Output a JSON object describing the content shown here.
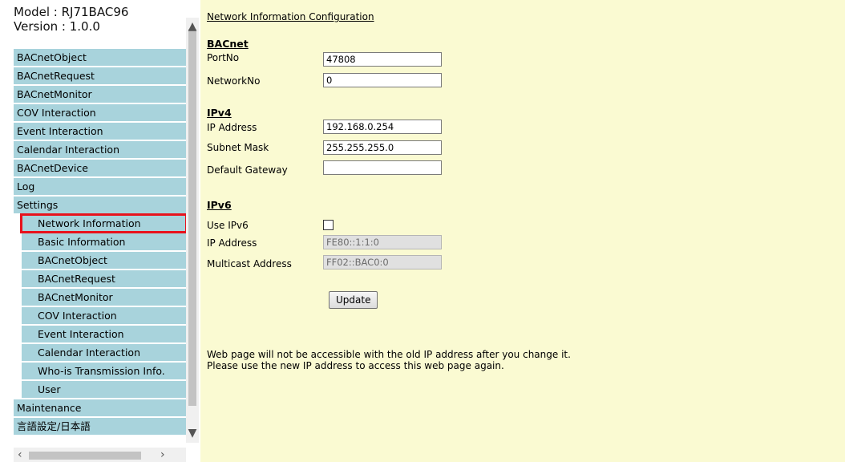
{
  "sidebar": {
    "model_line": "Model : RJ71BAC96",
    "version_line": "Version : 1.0.0",
    "items": [
      {
        "label": "BACnetObject",
        "sub": false,
        "selected": false
      },
      {
        "label": "BACnetRequest",
        "sub": false,
        "selected": false
      },
      {
        "label": "BACnetMonitor",
        "sub": false,
        "selected": false
      },
      {
        "label": "COV Interaction",
        "sub": false,
        "selected": false
      },
      {
        "label": "Event Interaction",
        "sub": false,
        "selected": false
      },
      {
        "label": "Calendar Interaction",
        "sub": false,
        "selected": false
      },
      {
        "label": "BACnetDevice",
        "sub": false,
        "selected": false
      },
      {
        "label": "Log",
        "sub": false,
        "selected": false
      },
      {
        "label": "Settings",
        "sub": false,
        "selected": false
      },
      {
        "label": "Network Information",
        "sub": true,
        "selected": true
      },
      {
        "label": "Basic Information",
        "sub": true,
        "selected": false
      },
      {
        "label": "BACnetObject",
        "sub": true,
        "selected": false
      },
      {
        "label": "BACnetRequest",
        "sub": true,
        "selected": false
      },
      {
        "label": "BACnetMonitor",
        "sub": true,
        "selected": false
      },
      {
        "label": "COV Interaction",
        "sub": true,
        "selected": false
      },
      {
        "label": "Event Interaction",
        "sub": true,
        "selected": false
      },
      {
        "label": "Calendar Interaction",
        "sub": true,
        "selected": false
      },
      {
        "label": "Who-is Transmission Info.",
        "sub": true,
        "selected": false
      },
      {
        "label": "User",
        "sub": true,
        "selected": false
      },
      {
        "label": "Maintenance",
        "sub": false,
        "selected": false
      },
      {
        "label": "言語設定/日本語",
        "sub": false,
        "selected": false
      }
    ],
    "scroll_up_icon": "▲",
    "scroll_down_icon": "▼",
    "scroll_left_icon": "‹",
    "scroll_right_icon": "›"
  },
  "main": {
    "title": "Network Information Configuration",
    "bacnet": {
      "heading": "BACnet",
      "port_label": "PortNo",
      "port_value": "47808",
      "network_label": "NetworkNo",
      "network_value": "0"
    },
    "ipv4": {
      "heading": "IPv4",
      "ip_label": "IP Address",
      "ip_value": "192.168.0.254",
      "subnet_label": "Subnet Mask",
      "subnet_value": "255.255.255.0",
      "gateway_label": "Default Gateway",
      "gateway_value": ""
    },
    "ipv6": {
      "heading": "IPv6",
      "use_label": "Use IPv6",
      "use_checked": false,
      "ip_label": "IP Address",
      "ip_value": "FE80::1:1:0",
      "multicast_label": "Multicast Address",
      "multicast_value": "FF02::BAC0:0"
    },
    "update_button": "Update",
    "message_line1": "Web page will not be accessible with the old IP address after you change it.",
    "message_line2": "Please use the new IP address to access this web page again."
  },
  "colors": {
    "menu_bg": "#a8d3dc",
    "content_bg": "#fafad2",
    "selected_outline": "#e8121c"
  }
}
